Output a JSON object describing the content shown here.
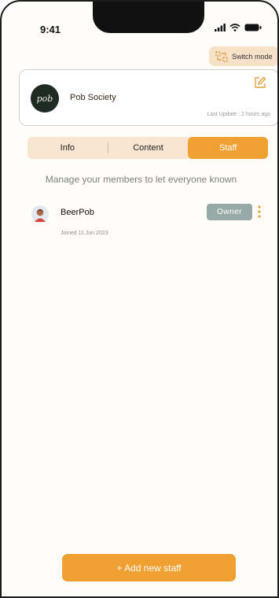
{
  "status_bar": {
    "time": "9:41"
  },
  "header": {
    "switch_mode_label": "Switch mode"
  },
  "org": {
    "logo_text": "pob",
    "name": "Pob Society",
    "last_update": "Last Update : 2 hours ago"
  },
  "tabs": [
    {
      "label": "Info",
      "active": false
    },
    {
      "label": "Content",
      "active": false
    },
    {
      "label": "Staff",
      "active": true
    }
  ],
  "staff": {
    "subtitle": "Manage your members to let everyone known",
    "members": [
      {
        "name": "BeerPob",
        "joined": "Joined 11 Jun 2023",
        "role": "Owner"
      }
    ]
  },
  "actions": {
    "add_staff_label": "+ Add new staff"
  },
  "colors": {
    "accent": "#f0a030",
    "tab_bg": "#f8e6d2",
    "badge": "#98aaa6"
  },
  "icons": [
    "signal-icon",
    "wifi-icon",
    "battery-icon",
    "switch-mode-icon",
    "edit-icon",
    "more-vertical-icon",
    "avatar-icon"
  ]
}
